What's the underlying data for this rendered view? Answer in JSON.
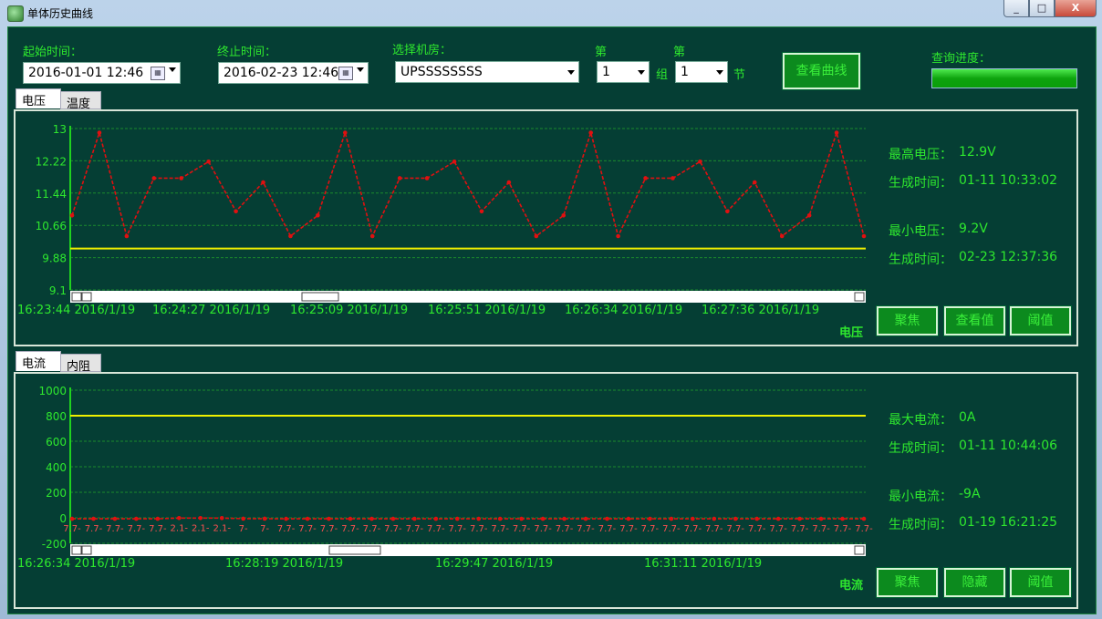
{
  "window": {
    "title": "单体历史曲线",
    "min": "_",
    "max": "□",
    "close": "X"
  },
  "query": {
    "start_label": "起始时间：",
    "start_value": "2016-01-01 12:46",
    "end_label": "终止时间：",
    "end_value": "2016-02-23 12:46",
    "room_label": "选择机房：",
    "room_value": "UPSSSSSSSS",
    "group_prefix": "第",
    "group_value": "1",
    "group_suffix": "组",
    "section_prefix": "第",
    "section_value": "1",
    "section_suffix": "节",
    "view_button": "查看曲线",
    "progress_label": "查询进度：",
    "progress": 1.0
  },
  "top_panel": {
    "tabs": [
      "电压",
      "温度"
    ],
    "active_tab": 0,
    "info": {
      "max_label": "最高电压：",
      "max_value": "12.9V",
      "max_time_label": "生成时间：",
      "max_time_value": "01-11 10:33:02",
      "min_label": "最小电压：",
      "min_value": "9.2V",
      "min_time_label": "生成时间：",
      "min_time_value": "02-23 12:37:36"
    },
    "buttons": {
      "focus": "聚焦",
      "view": "查看值",
      "threshold": "阈值"
    },
    "axis_name": "电压"
  },
  "bottom_panel": {
    "tabs": [
      "电流",
      "内阻"
    ],
    "active_tab": 0,
    "info": {
      "max_label": "最大电流：",
      "max_value": "0A",
      "max_time_label": "生成时间：",
      "max_time_value": "01-11 10:44:06",
      "min_label": "最小电流：",
      "min_value": "-9A",
      "min_time_label": "生成时间：",
      "min_time_value": "01-19 16:21:25"
    },
    "buttons": {
      "focus": "聚焦",
      "hide": "隐藏",
      "threshold": "阈值"
    },
    "axis_name": "电流"
  },
  "colors": {
    "series": "#e01010",
    "threshold": "#f0f000",
    "grid": "#1c8a2c",
    "text": "#2ee82e",
    "bg": "#053e34"
  },
  "chart_data": [
    {
      "type": "line",
      "yticks": [
        "13",
        "12.22",
        "11.44",
        "10.66",
        "9.88",
        "9.1"
      ],
      "ylim": [
        9.1,
        13
      ],
      "xtick_labels": [
        "16:23:44 2016/1/19",
        "16:24:27 2016/1/19",
        "16:25:09 2016/1/19",
        "16:25:51 2016/1/19",
        "16:26:34 2016/1/19",
        "16:27:36 2016/1/19"
      ],
      "series": [
        {
          "values": [
            10.9,
            12.9,
            10.4,
            11.8,
            11.8,
            12.2,
            11.0,
            11.7,
            10.4,
            10.9,
            12.9,
            10.4,
            11.8,
            11.8,
            12.2,
            11.0,
            11.7,
            10.4,
            10.9,
            12.9,
            10.4,
            11.8,
            11.8,
            12.2,
            11.0,
            11.7,
            10.4,
            10.9,
            12.9,
            10.4
          ]
        }
      ],
      "threshold": 10.1
    },
    {
      "type": "line",
      "yticks": [
        "1000",
        "800",
        "600",
        "400",
        "200",
        "0",
        "-200"
      ],
      "ylim": [
        -200,
        1000
      ],
      "xtick_labels": [
        "16:26:34 2016/1/19",
        "16:28:19 2016/1/19",
        "16:29:47 2016/1/19",
        "16:31:11 2016/1/19"
      ],
      "series": [
        {
          "values": [
            -7.7,
            -7.7,
            -7.7,
            -7.7,
            -7.7,
            -2.1,
            -2.1,
            -2.1,
            -7,
            -7,
            -7.7,
            -7.7,
            -7.7,
            -7.7,
            -7.7,
            -7.7,
            -7.7,
            -7.7,
            -7.7,
            -7.7,
            -7.7,
            -7.7,
            -7.7,
            -7.7,
            -7.7,
            -7.7,
            -7.7,
            -7.7,
            -7.7,
            -7.7,
            -7.7,
            -7.7,
            -7.7,
            -7.7,
            -7.7,
            -7.7,
            -7.7,
            -7.7
          ]
        }
      ],
      "point_labels": [
        "7.7-",
        "7.7-",
        "7.7-",
        "7.7-",
        "7.7-",
        "2.1-",
        "2.1-",
        "2.1-",
        "7-",
        "7-",
        "7.7-",
        "7.7-",
        "7.7-",
        "7.7-",
        "7.7-",
        "7.7-",
        "7.7-",
        "7.7-",
        "7.7-",
        "7.7-",
        "7.7-",
        "7.7-",
        "7.7-",
        "7.7-",
        "7.7-",
        "7.7-",
        "7.7-",
        "7.7-",
        "7.7-",
        "7.7-",
        "7.7-",
        "7.7-",
        "7.7-",
        "7.7-",
        "7.7-",
        "7.7-",
        "7.7-",
        "7.7-"
      ],
      "threshold": 800
    }
  ]
}
